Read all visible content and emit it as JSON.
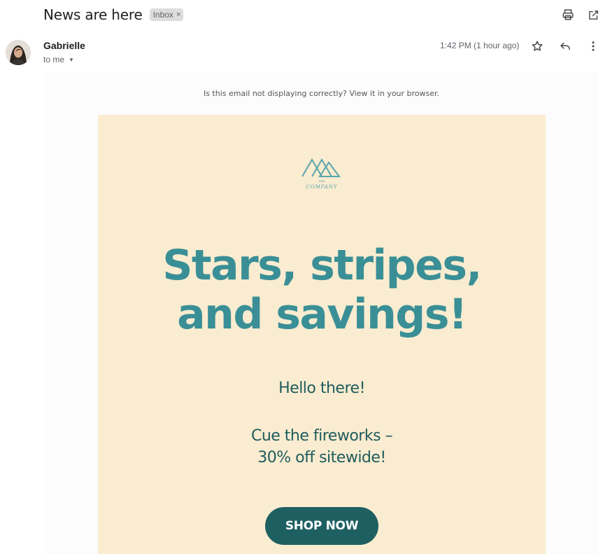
{
  "header": {
    "subject": "News are here",
    "label_chip": "Inbox",
    "chip_close": "×"
  },
  "toolbar_icons": [
    "print-icon",
    "open-in-new-window-icon"
  ],
  "message": {
    "sender": "Gabrielle",
    "recipient": "to me",
    "timestamp": "1:42 PM (1 hour ago)",
    "action_icons": [
      "star-icon",
      "reply-icon",
      "more-vert-icon"
    ]
  },
  "email": {
    "preheader": "Is this email not displaying correctly? View it in your browser.",
    "logo": {
      "small_text": "THE",
      "brand": "COMPANY"
    },
    "headline_line1": "Stars, stripes,",
    "headline_line2": "and savings!",
    "greeting": "Hello there!",
    "offer_line1": "Cue the fireworks –",
    "offer_line2": "30% off sitewide!",
    "cta_label": "SHOP NOW"
  },
  "colors": {
    "card_background": "#faecd0",
    "headline": "#3a8f96",
    "body_text": "#1f5c5e",
    "button": "#1e5f62",
    "label_chip": "#dddddd"
  }
}
